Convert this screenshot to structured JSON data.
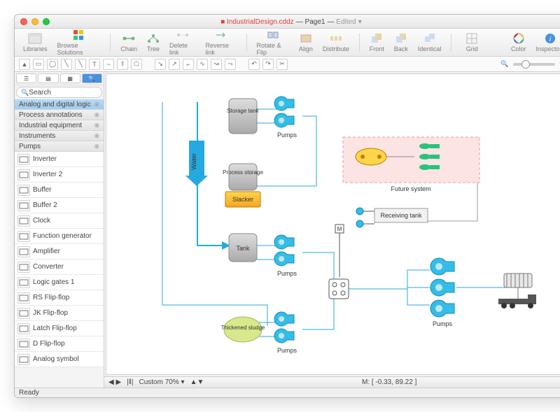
{
  "title": {
    "doc": "IndustrialDesign.cddz",
    "page": "Page1",
    "edited": "Edited"
  },
  "toolbar": {
    "libraries": "Libraries",
    "browse": "Browse Solutions",
    "chain": "Chain",
    "tree": "Tree",
    "deletelink": "Delete link",
    "reverselink": "Reverse link",
    "rotate": "Rotate & Flip",
    "align": "Align",
    "distribute": "Distribute",
    "front": "Front",
    "back": "Back",
    "identical": "Identical",
    "grid": "Grid",
    "color": "Color",
    "inspectors": "Inspectors"
  },
  "search": {
    "placeholder": "Search"
  },
  "categories": [
    {
      "label": "Analog and digital logic",
      "sel": true
    },
    {
      "label": "Process annotations"
    },
    {
      "label": "Industrial equipment"
    },
    {
      "label": "Instruments"
    },
    {
      "label": "Pumps"
    }
  ],
  "stencils": [
    "Inverter",
    "Inverter 2",
    "Buffer",
    "Buffer 2",
    "Clock",
    "Function generator",
    "Amplifier",
    "Converter",
    "Logic gates 1",
    "RS Flip-flop",
    "JK Flip-flop",
    "Latch Flip-flop",
    "D Flip-flop",
    "Analog symbol"
  ],
  "diagram": {
    "storage": "Storage tank",
    "pumps": "Pumps",
    "water": "Water",
    "process": "Process storage",
    "slacker": "Slacker",
    "tank": "Tank",
    "sludge": "Thickened sludge",
    "future": "Future system",
    "receiving": "Receiving tank",
    "m": "M"
  },
  "zoom": {
    "label": "Custom 70%"
  },
  "status": {
    "coords": "M: [ -0.33, 89.22 ]",
    "ready": "Ready"
  }
}
